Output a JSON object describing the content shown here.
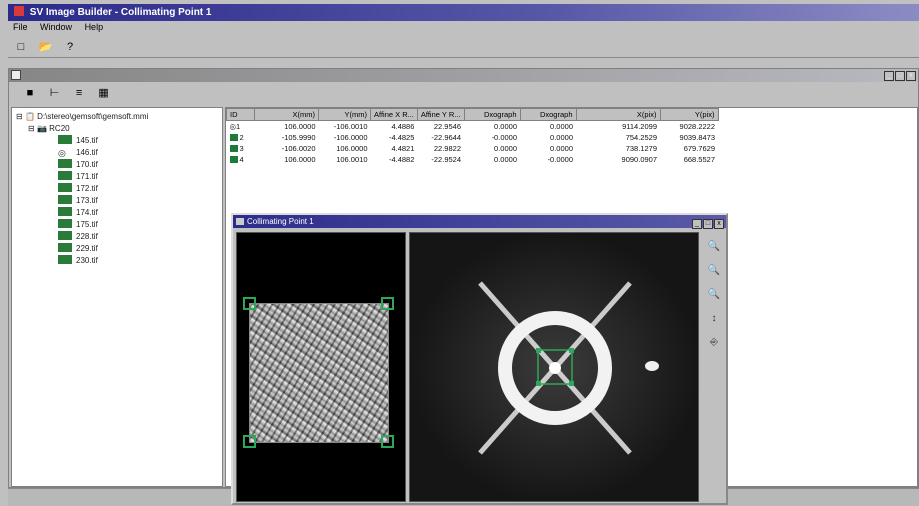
{
  "window": {
    "title": "SV Image Builder - Collimating Point 1"
  },
  "menu": [
    "File",
    "Window",
    "Help"
  ],
  "subwindow": {
    "title": ""
  },
  "tree": [
    {
      "label": "D:\\stereo\\gemsoft\\gemsoft.mmi",
      "icon": "project-icon"
    },
    {
      "label": "RC20",
      "icon": "camera-icon"
    },
    {
      "label": "145.tif",
      "icon": "image-icon"
    },
    {
      "label": "146.tif",
      "icon": "eye-icon"
    },
    {
      "label": "170.tif",
      "icon": "image-icon"
    },
    {
      "label": "171.tif",
      "icon": "image-icon"
    },
    {
      "label": "172.tif",
      "icon": "image-icon"
    },
    {
      "label": "173.tif",
      "icon": "image-icon"
    },
    {
      "label": "174.tif",
      "icon": "image-icon"
    },
    {
      "label": "175.tif",
      "icon": "image-icon"
    },
    {
      "label": "228.tif",
      "icon": "image-icon"
    },
    {
      "label": "229.tif",
      "icon": "image-icon"
    },
    {
      "label": "230.tif",
      "icon": "image-icon"
    }
  ],
  "table": {
    "headers": [
      "ID",
      "X(mm)",
      "Y(mm)",
      "Affine X R...",
      "Affine Y R...",
      "Dxograph",
      "Dxograph",
      "X(pix)",
      "Y(pix)"
    ],
    "rows": [
      [
        "1",
        "106.0000",
        "-106.0010",
        "4.4886",
        "22.9546",
        "0.0000",
        "0.0000",
        "9114.2099",
        "9028.2222"
      ],
      [
        "2",
        "-105.9990",
        "-106.0000",
        "-4.4825",
        "-22.9644",
        "-0.0000",
        "0.0000",
        "754.2529",
        "9039.8473"
      ],
      [
        "3",
        "-106.0020",
        "106.0000",
        "4.4821",
        "22.9822",
        "0.0000",
        "0.0000",
        "738.1279",
        "679.7629"
      ],
      [
        "4",
        "106.0000",
        "106.0010",
        "-4.4882",
        "-22.9524",
        "0.0000",
        "-0.0000",
        "9090.0907",
        "668.5527"
      ]
    ]
  },
  "popup": {
    "title": "Collimating Point 1"
  },
  "colors": {
    "title_bar": "#2a2a8a",
    "marker": "#2ba85a",
    "sq": "#1e7a3a"
  }
}
